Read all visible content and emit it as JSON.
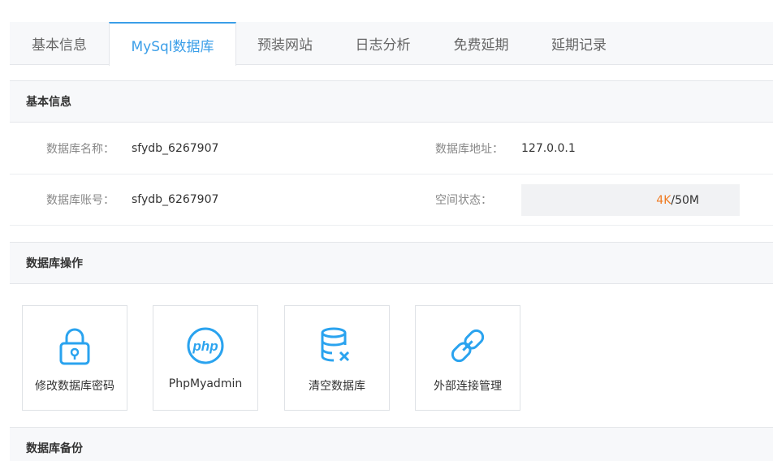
{
  "tabs": [
    {
      "label": "基本信息",
      "active": false
    },
    {
      "label": "MySql数据库",
      "active": true
    },
    {
      "label": "预装网站",
      "active": false
    },
    {
      "label": "日志分析",
      "active": false
    },
    {
      "label": "免费延期",
      "active": false
    },
    {
      "label": "延期记录",
      "active": false
    }
  ],
  "basic_info": {
    "title": "基本信息",
    "db_name_label": "数据库名称：",
    "db_name_value": "sfydb_6267907",
    "db_address_label": "数据库地址：",
    "db_address_value": "127.0.0.1",
    "db_account_label": "数据库账号：",
    "db_account_value": "sfydb_6267907",
    "space_label": "空间状态：",
    "space_used": "4K",
    "space_total": "/50M"
  },
  "operations": {
    "title": "数据库操作",
    "items": [
      {
        "label": "修改数据库密码",
        "icon": "lock-icon"
      },
      {
        "label": "PhpMyadmin",
        "icon": "php-icon"
      },
      {
        "label": "清空数据库",
        "icon": "database-clear-icon"
      },
      {
        "label": "外部连接管理",
        "icon": "link-icon"
      }
    ]
  },
  "backup": {
    "title": "数据库备份"
  },
  "colors": {
    "accent": "#3a9ee8",
    "icon": "#2aa3ef",
    "space_used": "#f07b22"
  }
}
